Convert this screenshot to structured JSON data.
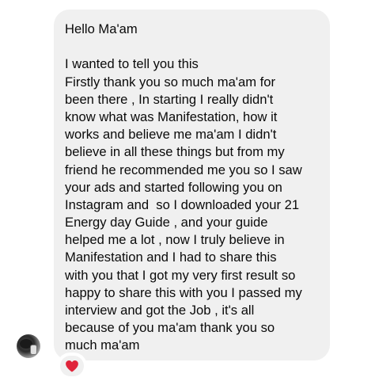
{
  "message": {
    "greeting": "Hello Ma'am",
    "lines": [
      "I wanted to tell you this",
      "Firstly thank you so much ma'am for",
      "been there , In starting I really didn't",
      "know what was Manifestation, how it",
      "works and believe me ma'am I didn't",
      "believe in all these things but from my",
      "friend he recommended me you so I saw",
      "your ads and started following you on",
      "Instagram and  so I downloaded your 21",
      "Energy day Guide , and your guide",
      "helped me a lot , now I truly believe in",
      "Manifestation and I had to share this",
      "with you that I got my very first result so",
      "happy to share this with you I passed my",
      "interview and got the Job , it's all",
      "because of you ma'am thank you so",
      "much ma'am"
    ]
  },
  "reaction": {
    "icon": "heart-icon",
    "color": "#e0243a"
  },
  "sender": {
    "avatar": "avatar"
  }
}
